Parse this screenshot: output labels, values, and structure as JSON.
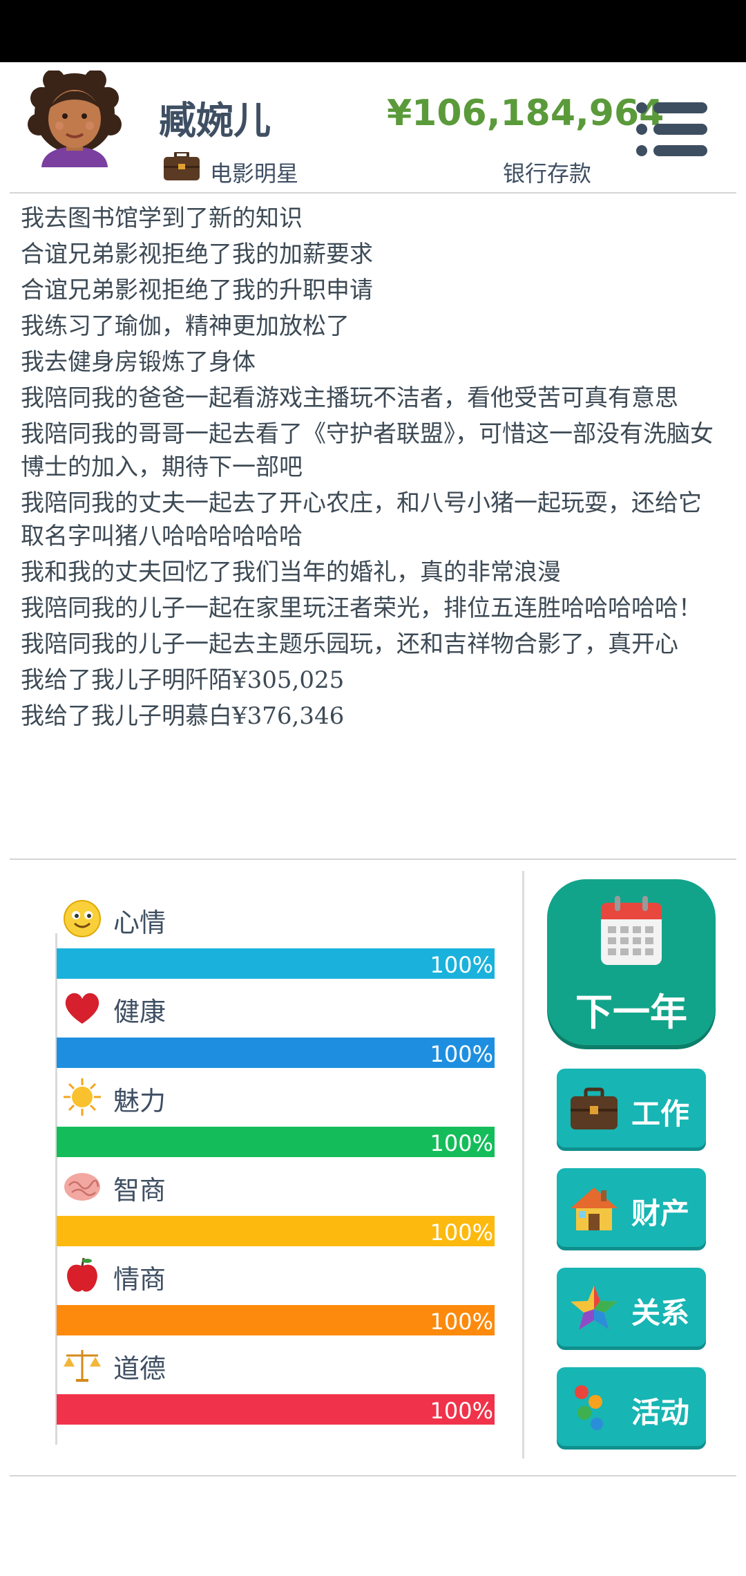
{
  "header": {
    "player_name": "臧婉儿",
    "job_title": "电影明星",
    "money": "¥106,184,964",
    "money_label": "银行存款"
  },
  "log": [
    "我去图书馆学到了新的知识",
    "合谊兄弟影视拒绝了我的加薪要求",
    "合谊兄弟影视拒绝了我的升职申请",
    "我练习了瑜伽，精神更加放松了",
    "我去健身房锻炼了身体",
    "我陪同我的爸爸一起看游戏主播玩不洁者，看他受苦可真有意思",
    "我陪同我的哥哥一起去看了《守护者联盟》，可惜这一部没有洗脑女博士的加入，期待下一部吧",
    "我陪同我的丈夫一起去了开心农庄，和八号小猪一起玩耍，还给它取名字叫猪八哈哈哈哈哈哈",
    "我和我的丈夫回忆了我们当年的婚礼，真的非常浪漫",
    "我陪同我的儿子一起在家里玩汪者荣光，排位五连胜哈哈哈哈哈！",
    "我陪同我的儿子一起去主题乐园玩，还和吉祥物合影了，真开心",
    "我给了我儿子明阡陌¥305,025",
    "我给了我儿子明慕白¥376,346"
  ],
  "stats": [
    {
      "label": "心情",
      "icon": "smiley-icon",
      "value": 100,
      "percent_text": "100%",
      "color": "#1ab2dc"
    },
    {
      "label": "健康",
      "icon": "heart-icon",
      "value": 100,
      "percent_text": "100%",
      "color": "#1e8fe0"
    },
    {
      "label": "魅力",
      "icon": "sun-icon",
      "value": 100,
      "percent_text": "100%",
      "color": "#14bd5a"
    },
    {
      "label": "智商",
      "icon": "brain-icon",
      "value": 100,
      "percent_text": "100%",
      "color": "#fdb90d"
    },
    {
      "label": "情商",
      "icon": "apple-icon",
      "value": 100,
      "percent_text": "100%",
      "color": "#fd8a0c"
    },
    {
      "label": "道德",
      "icon": "scale-icon",
      "value": 100,
      "percent_text": "100%",
      "color": "#f0334a"
    }
  ],
  "buttons": {
    "next_year": "下一年",
    "work": "工作",
    "property": "财产",
    "relations": "关系",
    "activities": "活动"
  }
}
